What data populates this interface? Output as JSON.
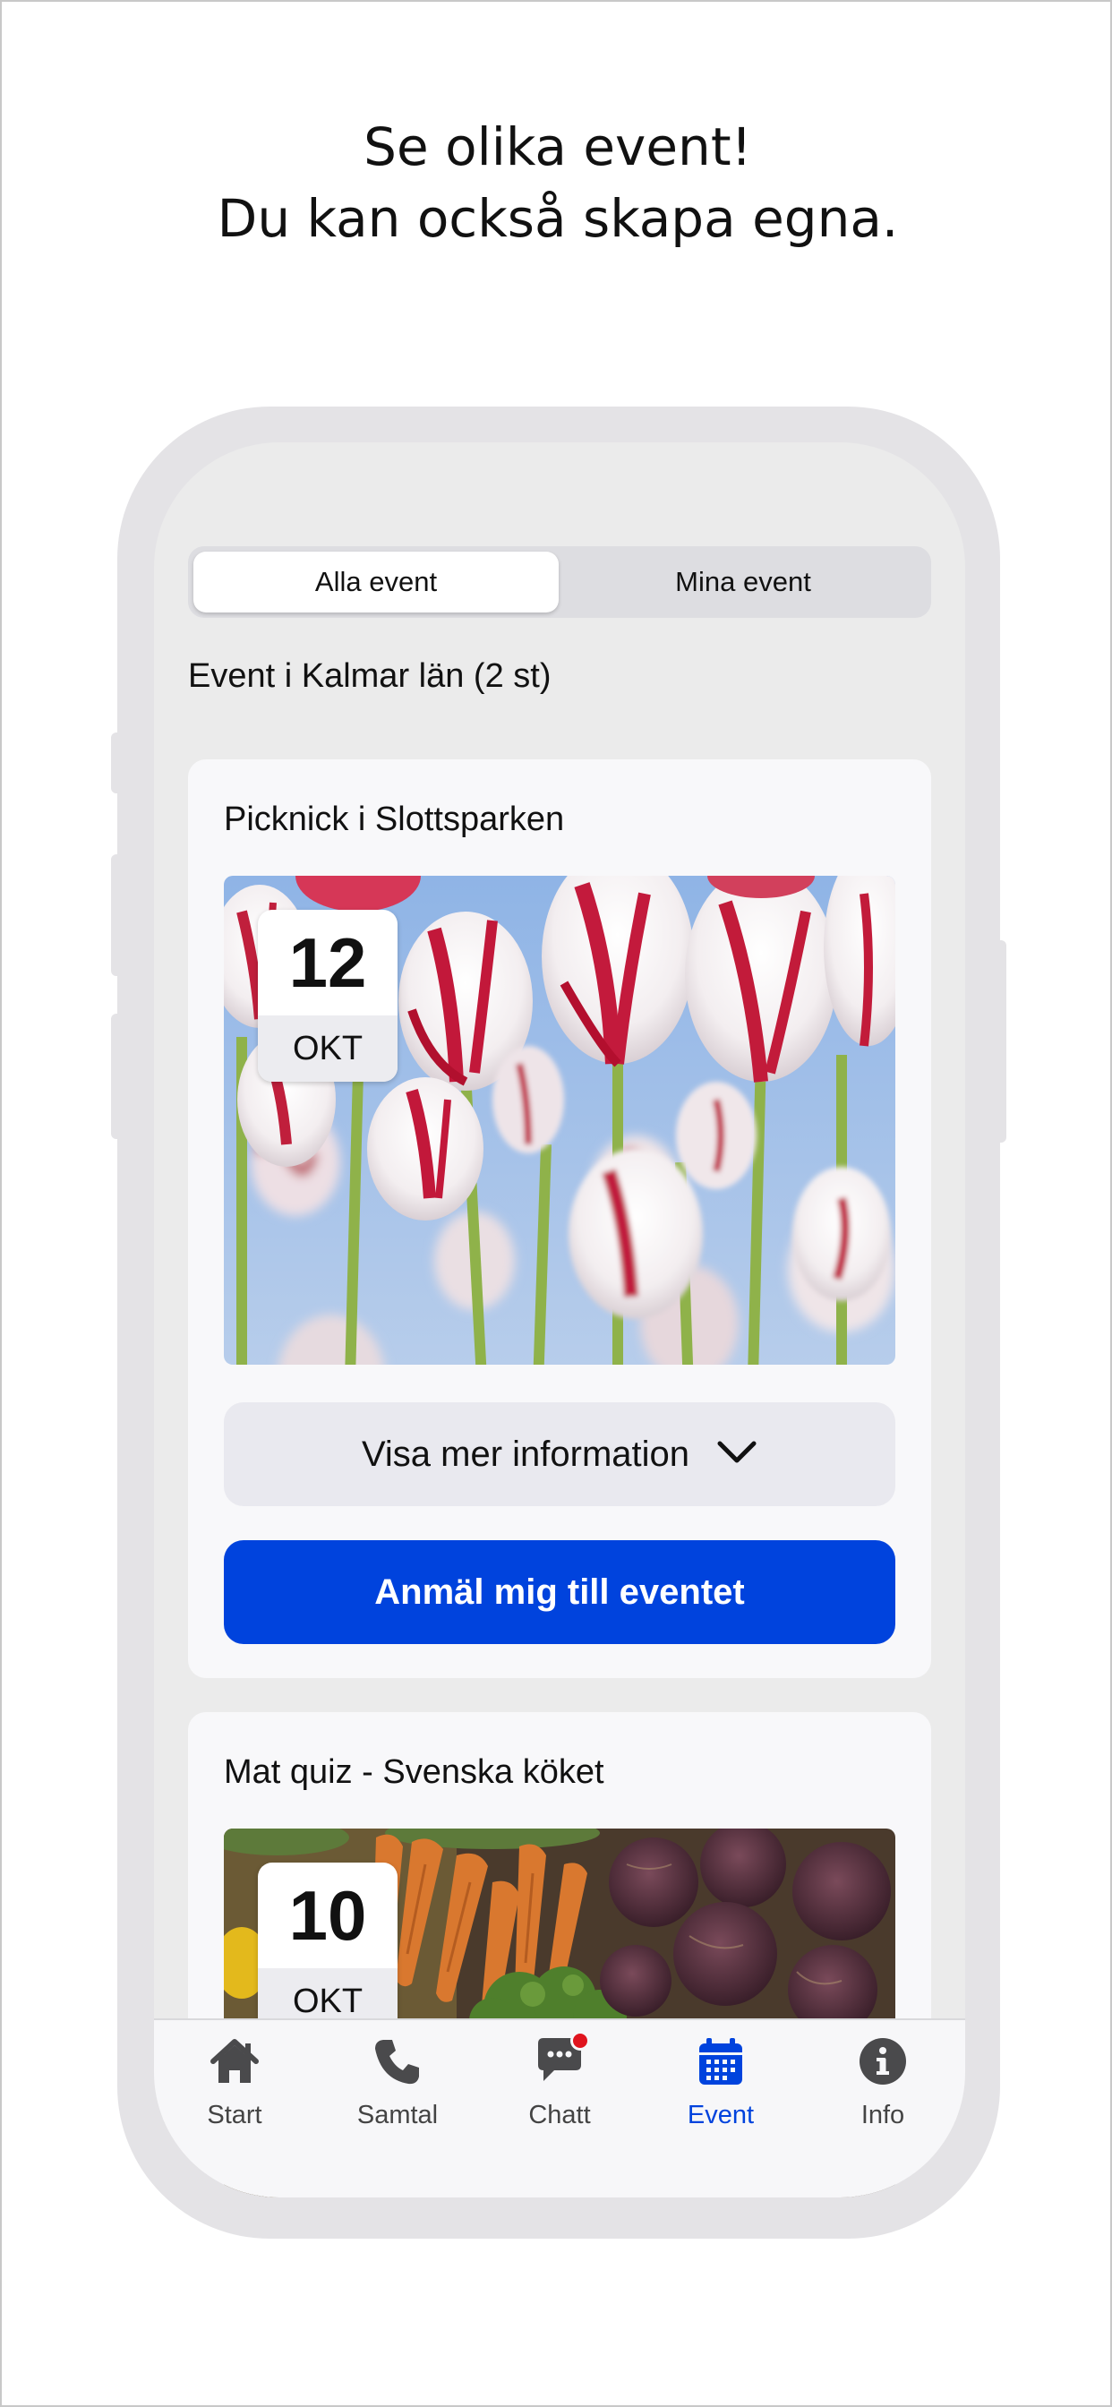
{
  "headline": {
    "line1": "Se olika event!",
    "line2": "Du kan också skapa egna."
  },
  "segmented": {
    "all_label": "Alla event",
    "mine_label": "Mina event",
    "selected": "Alla event"
  },
  "section_title": "Event i Kalmar län (2 st)",
  "events": [
    {
      "title": "Picknick i Slottsparken",
      "day": "12",
      "month": "OKT",
      "more_label": "Visa mer information",
      "signup_label": "Anmäl mig till eventet",
      "image": "tulips-photo"
    },
    {
      "title": "Mat quiz - Svenska köket",
      "day": "10",
      "month": "OKT",
      "image": "vegetables-photo"
    }
  ],
  "tabbar": {
    "items": [
      {
        "label": "Start",
        "icon": "home-icon"
      },
      {
        "label": "Samtal",
        "icon": "phone-icon"
      },
      {
        "label": "Chatt",
        "icon": "chat-icon",
        "has_badge": true
      },
      {
        "label": "Event",
        "icon": "calendar-icon",
        "active": true
      },
      {
        "label": "Info",
        "icon": "info-icon"
      }
    ]
  },
  "colors": {
    "accent": "#0043dd",
    "badge": "#e0141e",
    "frame": "#e4e3e6"
  }
}
